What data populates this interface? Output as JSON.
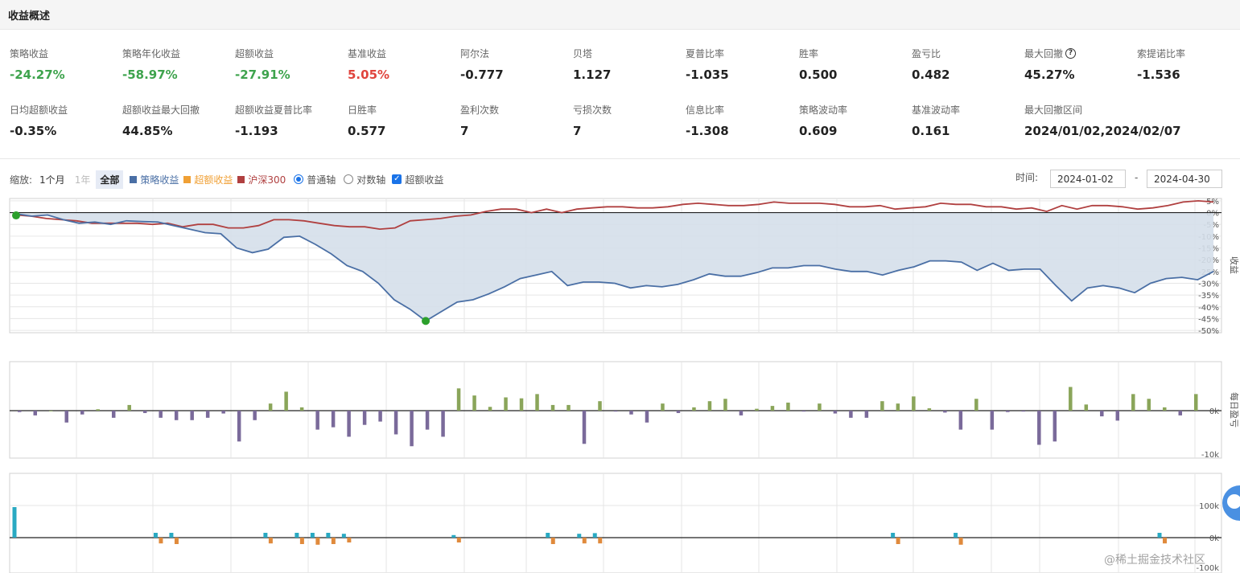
{
  "header": {
    "title": "收益概述"
  },
  "metrics_row1": [
    {
      "label": "策略收益",
      "value": "-24.27%",
      "tone": "neg"
    },
    {
      "label": "策略年化收益",
      "value": "-58.97%",
      "tone": "neg"
    },
    {
      "label": "超额收益",
      "value": "-27.91%",
      "tone": "neg"
    },
    {
      "label": "基准收益",
      "value": "5.05%",
      "tone": "pos"
    },
    {
      "label": "阿尔法",
      "value": "-0.777",
      "tone": ""
    },
    {
      "label": "贝塔",
      "value": "1.127",
      "tone": ""
    },
    {
      "label": "夏普比率",
      "value": "-1.035",
      "tone": ""
    },
    {
      "label": "胜率",
      "value": "0.500",
      "tone": ""
    },
    {
      "label": "盈亏比",
      "value": "0.482",
      "tone": ""
    },
    {
      "label": "最大回撤",
      "value": "45.27%",
      "tone": "",
      "help": true
    },
    {
      "label": "索提诺比率",
      "value": "-1.536",
      "tone": ""
    }
  ],
  "metrics_row2": [
    {
      "label": "日均超额收益",
      "value": "-0.35%"
    },
    {
      "label": "超额收益最大回撤",
      "value": "44.85%"
    },
    {
      "label": "超额收益夏普比率",
      "value": "-1.193"
    },
    {
      "label": "日胜率",
      "value": "0.577"
    },
    {
      "label": "盈利次数",
      "value": "7"
    },
    {
      "label": "亏损次数",
      "value": "7"
    },
    {
      "label": "信息比率",
      "value": "-1.308"
    },
    {
      "label": "策略波动率",
      "value": "0.609"
    },
    {
      "label": "基准波动率",
      "value": "0.161"
    },
    {
      "label": "最大回撤区间",
      "value": "2024/01/02,2024/02/07"
    }
  ],
  "help_icon_glyph": "?",
  "toolbar": {
    "zoom_label": "缩放:",
    "zoom_1m": "1个月",
    "zoom_1y": "1年",
    "zoom_all": "全部",
    "legend_strategy": "策略收益",
    "legend_excess": "超额收益",
    "legend_benchmark": "沪深300",
    "axis_normal": "普通轴",
    "axis_log": "对数轴",
    "excess_toggle": "超额收益",
    "checkbox_mark": "✓",
    "time_label": "时间:",
    "date_start": "2024-01-02",
    "date_sep": "-",
    "date_end": "2024-04-30"
  },
  "colors": {
    "strategy": "#4a6fa5",
    "excess": "#f0a035",
    "benchmark": "#b04040",
    "area_fill": "#d5dfea",
    "profit_bar": "#8aa55a",
    "loss_bar": "#7a6a9a",
    "buy_bar": "#29a9c2",
    "sell_bar": "#e08a3c",
    "neg_value": "#3ea34d",
    "pos_value": "#e0443d"
  },
  "chart_data": [
    {
      "type": "line",
      "title": "",
      "ylabel": "收益",
      "y_ticks": [
        "5%",
        "0%",
        "-5%",
        "-10%",
        "-15%",
        "-20%",
        "-25%",
        "-30%",
        "-35%",
        "-40%",
        "-45%",
        "-50%"
      ],
      "ylim": [
        -51,
        6
      ],
      "series": [
        {
          "name": "策略收益",
          "values": [
            -0.5,
            -1.5,
            -1,
            -3,
            -4.5,
            -4,
            -5,
            -3.5,
            -3.8,
            -4,
            -5.5,
            -7,
            -8.5,
            -9,
            -15,
            -17,
            -15.5,
            -10.5,
            -10,
            -13.5,
            -17.5,
            -22.5,
            -25,
            -30,
            -37,
            -41,
            -46,
            -42,
            -38,
            -37,
            -34.5,
            -31.5,
            -28,
            -26.5,
            -25,
            -31,
            -29.5,
            -29.5,
            -30,
            -32,
            -31,
            -31.5,
            -30.5,
            -28.5,
            -26,
            -27,
            -27,
            -25.5,
            -23.5,
            -23.5,
            -22.5,
            -22.5,
            -24,
            -25,
            -25,
            -26.5,
            -24.5,
            -23,
            -20.5,
            -20.5,
            -21,
            -24.5,
            -21.5,
            -24.5,
            -24,
            -24,
            -31,
            -37.5,
            -32,
            -31,
            -32,
            -34,
            -30,
            -28,
            -27.5,
            -28.5,
            -25
          ]
        },
        {
          "name": "沪深300",
          "values": [
            -1,
            -1.5,
            -2.5,
            -3,
            -3.5,
            -4.5,
            -4.5,
            -4.5,
            -4.5,
            -5,
            -4.5,
            -6,
            -5,
            -5,
            -6.5,
            -6.5,
            -5.5,
            -3,
            -3,
            -3.5,
            -4.5,
            -5.5,
            -6,
            -6,
            -7,
            -6.5,
            -3.5,
            -3,
            -2.5,
            -1.5,
            -1,
            0.5,
            1.5,
            1.5,
            0,
            1.5,
            0,
            1.5,
            2,
            2.5,
            2.5,
            2,
            2,
            2.5,
            3.5,
            4,
            3.5,
            3,
            3,
            3.5,
            4.5,
            4,
            4,
            4,
            3.5,
            2.5,
            2.5,
            3,
            1.5,
            2,
            2.5,
            4,
            3.5,
            3.5,
            2.5,
            2.5,
            1.5,
            2,
            0.5,
            3,
            1.5,
            3,
            3,
            2.5,
            1.5,
            2,
            3,
            4.5,
            5,
            4.5
          ]
        }
      ]
    },
    {
      "type": "bar",
      "title": "",
      "ylabel": "每日盈亏",
      "y_ticks": [
        "0k",
        "-10k"
      ],
      "ylim": [
        -10,
        10
      ],
      "values": [
        -0.3,
        -1,
        0,
        -2.5,
        -0.8,
        0.3,
        -1.5,
        1.2,
        -0.5,
        -1.5,
        -2,
        -2,
        -1.5,
        -0.6,
        -6.5,
        -2,
        1.5,
        4,
        0.7,
        -4,
        -3.5,
        -5.5,
        -3,
        -2.3,
        -5,
        -7.5,
        -4,
        -5.5,
        4.7,
        3.2,
        0.8,
        2.8,
        2.6,
        3.5,
        1.2,
        1.2,
        -7,
        2,
        -0.2,
        -0.8,
        -2.5,
        1.5,
        -0.5,
        0.7,
        2,
        2.5,
        -1,
        0.4,
        1,
        1.7,
        -0.2,
        1.5,
        -0.6,
        -1.5,
        -1.5,
        2,
        1.5,
        3,
        0.5,
        -0.4,
        -4,
        2.5,
        -4,
        -0.3,
        -0.2,
        -7.2,
        -6.5,
        5,
        1.3,
        -1.2,
        -2.1,
        3.5,
        2.5,
        0.7,
        -1,
        3.5
      ]
    },
    {
      "type": "bar",
      "title": "",
      "y_ticks": [
        "100k",
        "0k",
        "-100k"
      ],
      "ylim": [
        -100,
        100
      ],
      "series": [
        {
          "name": "buy",
          "values": [
            {
              "i": 0,
              "v": 95
            },
            {
              "i": 9,
              "v": 15
            },
            {
              "i": 10,
              "v": 15
            },
            {
              "i": 16,
              "v": 15
            },
            {
              "i": 18,
              "v": 15
            },
            {
              "i": 19,
              "v": 15
            },
            {
              "i": 20,
              "v": 15
            },
            {
              "i": 21,
              "v": 12
            },
            {
              "i": 28,
              "v": 8
            },
            {
              "i": 34,
              "v": 15
            },
            {
              "i": 36,
              "v": 12
            },
            {
              "i": 37,
              "v": 14
            },
            {
              "i": 56,
              "v": 15
            },
            {
              "i": 60,
              "v": 15
            },
            {
              "i": 73,
              "v": 15
            }
          ]
        },
        {
          "name": "sell",
          "values": [
            {
              "i": 9,
              "v": -18
            },
            {
              "i": 10,
              "v": -20
            },
            {
              "i": 16,
              "v": -18
            },
            {
              "i": 18,
              "v": -20
            },
            {
              "i": 19,
              "v": -22
            },
            {
              "i": 20,
              "v": -20
            },
            {
              "i": 21,
              "v": -15
            },
            {
              "i": 28,
              "v": -15
            },
            {
              "i": 34,
              "v": -20
            },
            {
              "i": 36,
              "v": -18
            },
            {
              "i": 37,
              "v": -18
            },
            {
              "i": 56,
              "v": -20
            },
            {
              "i": 60,
              "v": -22
            },
            {
              "i": 73,
              "v": -18
            }
          ]
        }
      ]
    }
  ],
  "watermark": "@稀土掘金技术社区"
}
